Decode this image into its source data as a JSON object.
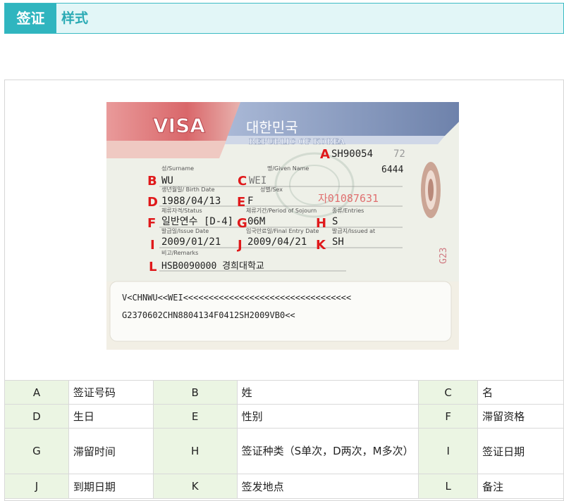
{
  "header": {
    "tab_label": "签证",
    "title": "样式"
  },
  "visa": {
    "visa_word": "VISA",
    "country_kr": "대한민국",
    "country_en": "REPUBLIC OF KOREA",
    "number": "SH90054",
    "number_tail": "72",
    "top_right_code": "6444",
    "fields": {
      "surname_label": "성/Surname",
      "surname": "WU",
      "given_name_label": "명/Given Name",
      "given_name": "WEI",
      "birth_label": "생년월일/ Birth Date",
      "birth": "1988/04/13",
      "sex_label": "성별/Sex",
      "sex": "F",
      "red_number": "자01087631",
      "status_label": "체류자격/Status",
      "status": "일반연수 [D-4]",
      "period_label": "체류기간/Period of Sojourn",
      "period": "06M",
      "entries_label": "종류/Entries",
      "entries": "S",
      "issue_label": "발급일/Issue Date",
      "issue": "2009/01/21",
      "final_label": "입국만료일/Final Entry Date",
      "final": "2009/04/21",
      "issued_at_label": "발급지/Issued at",
      "issued_at": "SH",
      "remarks_label": "비고/Remarks",
      "remarks": "HSB0090000 경희대학교"
    },
    "mrz_line1": "V<CHNWU<<WEI<<<<<<<<<<<<<<<<<<<<<<<<<<<<<<<<<",
    "mrz_line2": "G2370602CHN8804134F0412SH2009VB0<<",
    "side_code": "G23",
    "markers": {
      "A": "A",
      "B": "B",
      "C": "C",
      "D": "D",
      "E": "E",
      "F": "F",
      "G": "G",
      "H": "H",
      "I": "I",
      "J": "J",
      "K": "K",
      "L": "L"
    },
    "colors": {
      "red_band": "#d8565b",
      "blue_band": "#7e91b8",
      "marker": "#e0191b",
      "card": "#f3f0e6"
    }
  },
  "legend": {
    "rows": [
      [
        {
          "k": "A",
          "v": "签证号码"
        },
        {
          "k": "B",
          "v": "姓"
        },
        {
          "k": "C",
          "v": "名"
        }
      ],
      [
        {
          "k": "D",
          "v": "生日"
        },
        {
          "k": "E",
          "v": "性别"
        },
        {
          "k": "F",
          "v": "滞留资格"
        }
      ],
      [
        {
          "k": "G",
          "v": "滞留时间"
        },
        {
          "k": "H",
          "v": "签证种类（S单次，D两次，M多次）"
        },
        {
          "k": "I",
          "v": "签证日期"
        }
      ],
      [
        {
          "k": "J",
          "v": "到期日期"
        },
        {
          "k": "K",
          "v": "签发地点"
        },
        {
          "k": "L",
          "v": "备注"
        }
      ]
    ]
  }
}
